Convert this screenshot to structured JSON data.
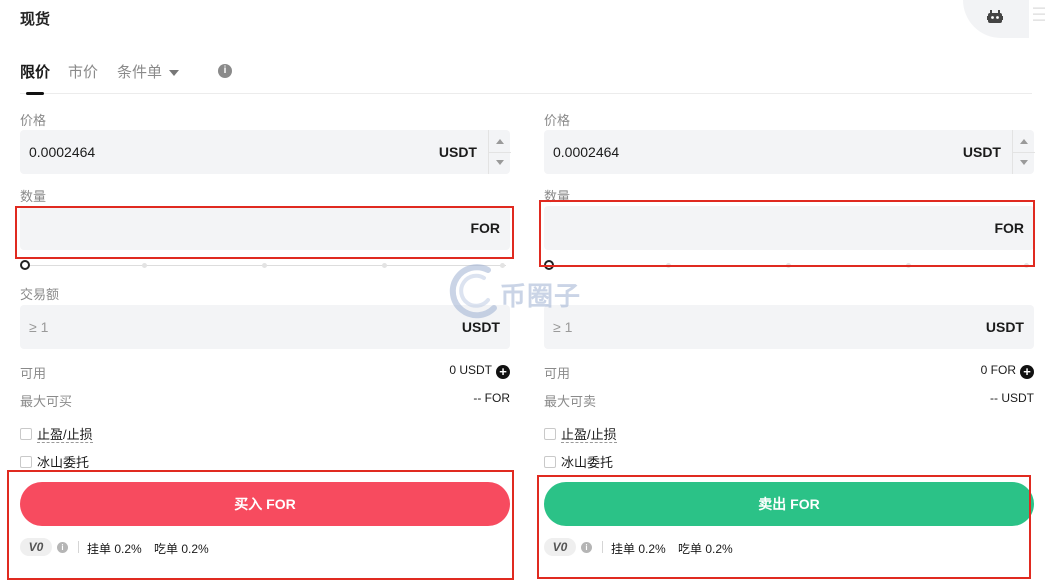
{
  "header": {
    "title": "现货"
  },
  "tabs": [
    {
      "label": "限价"
    },
    {
      "label": "市价"
    },
    {
      "label": "条件单"
    }
  ],
  "watermark_text": "币圈子",
  "buy": {
    "price_label": "价格",
    "price_value": "0.0002464",
    "price_unit": "USDT",
    "qty_label": "数量",
    "qty_unit": "FOR",
    "amount_label": "交易额",
    "amount_placeholder": "≥ 1",
    "amount_unit": "USDT",
    "available_label": "可用",
    "available_value": "0 USDT",
    "max_label": "最大可买",
    "max_value": "-- FOR",
    "tpsl_label": "止盈/止损",
    "iceberg_label": "冰山委托",
    "button_label": "买入 FOR",
    "vip_level": "V0",
    "maker_fee": "挂单 0.2%",
    "taker_fee": "吃单 0.2%",
    "color": "#f74b5f"
  },
  "sell": {
    "price_label": "价格",
    "price_value": "0.0002464",
    "price_unit": "USDT",
    "qty_label": "数量",
    "qty_unit": "FOR",
    "amount_placeholder": "≥ 1",
    "amount_unit": "USDT",
    "available_label": "可用",
    "available_value": "0 FOR",
    "max_label": "最大可卖",
    "max_value": "-- USDT",
    "tpsl_label": "止盈/止损",
    "iceberg_label": "冰山委托",
    "button_label": "卖出 FOR",
    "vip_level": "V0",
    "maker_fee": "挂单 0.2%",
    "taker_fee": "吃单 0.2%",
    "color": "#2bc287"
  },
  "slider": {
    "buy_percent": 0,
    "sell_percent": 0
  },
  "icons": [
    "robot-icon",
    "info-icon",
    "plus-icon",
    "chevron-down-icon",
    "arrow-up-icon",
    "arrow-down-icon"
  ]
}
